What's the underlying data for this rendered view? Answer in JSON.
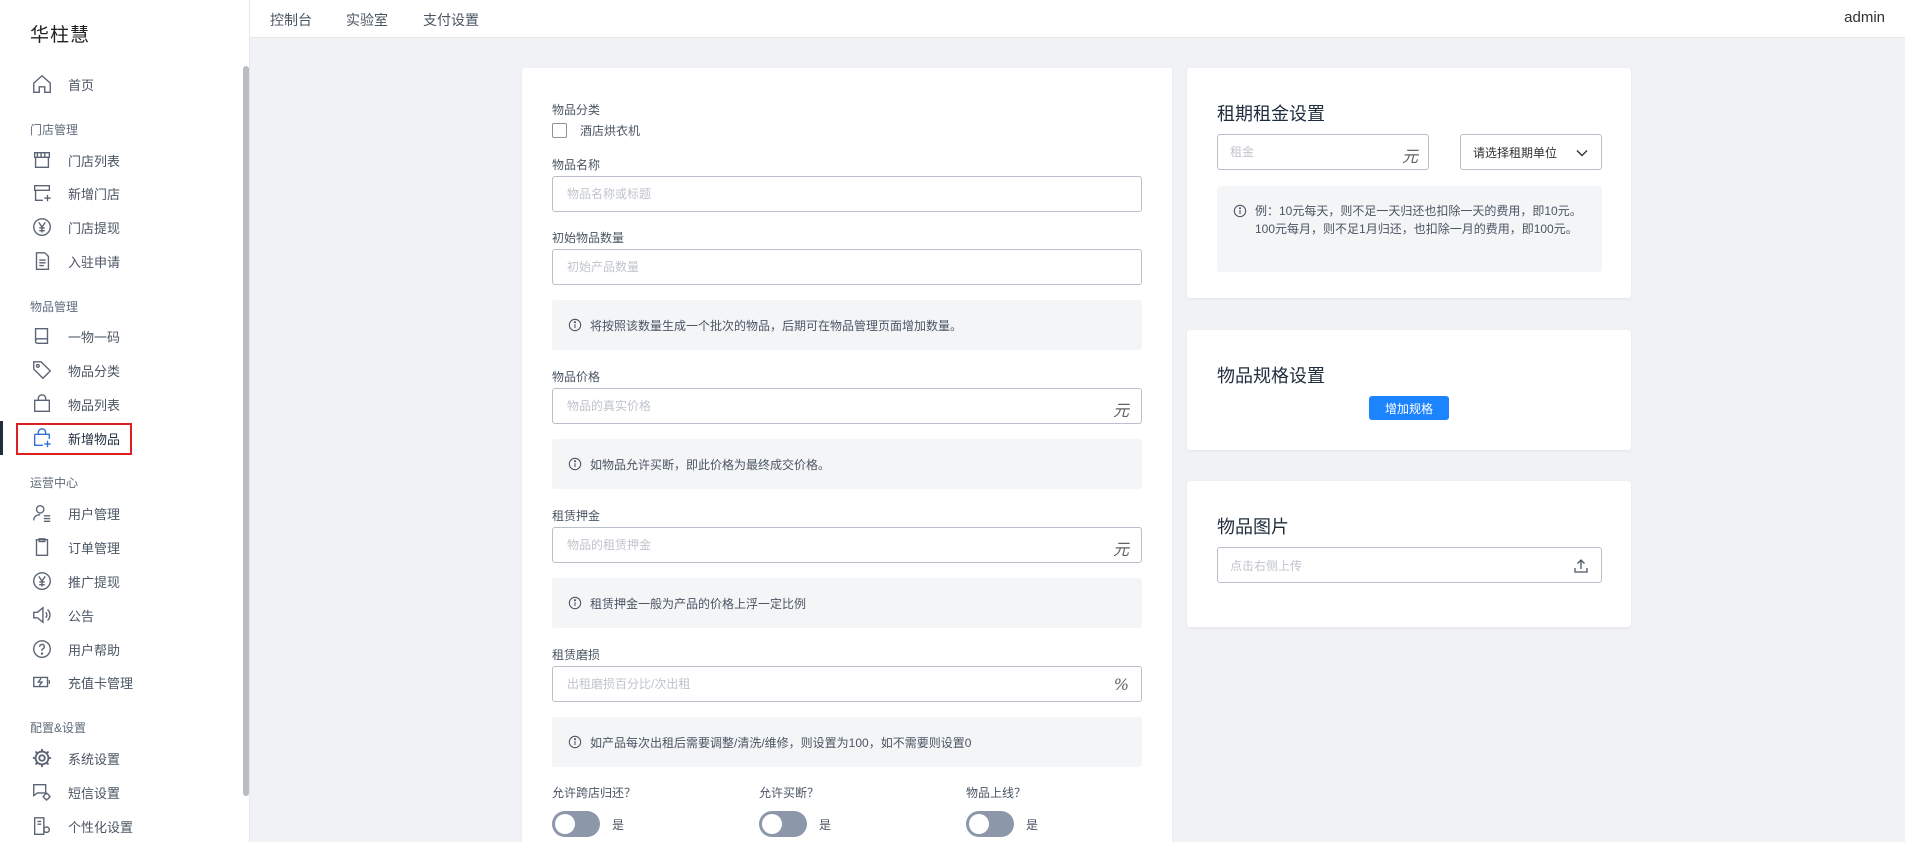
{
  "app": {
    "brand": "华柱慧",
    "user": "admin"
  },
  "topnav": [
    {
      "label": "控制台"
    },
    {
      "label": "实验室"
    },
    {
      "label": "支付设置"
    }
  ],
  "sidebar": {
    "home": {
      "label": "首页",
      "icon": "home-icon"
    },
    "sections": [
      {
        "title": "门店管理",
        "items": [
          {
            "label": "门店列表",
            "icon": "store-icon"
          },
          {
            "label": "新增门店",
            "icon": "add-store-icon"
          },
          {
            "label": "门店提现",
            "icon": "yen-icon"
          },
          {
            "label": "入驻申请",
            "icon": "document-icon"
          }
        ]
      },
      {
        "title": "物品管理",
        "items": [
          {
            "label": "一物一码",
            "icon": "book-icon"
          },
          {
            "label": "物品分类",
            "icon": "tag-icon"
          },
          {
            "label": "物品列表",
            "icon": "bag-icon"
          },
          {
            "label": "新增物品",
            "icon": "add-bag-icon",
            "active": true
          }
        ]
      },
      {
        "title": "运营中心",
        "items": [
          {
            "label": "用户管理",
            "icon": "user-icon"
          },
          {
            "label": "订单管理",
            "icon": "clipboard-icon"
          },
          {
            "label": "推广提现",
            "icon": "yen-icon"
          },
          {
            "label": "公告",
            "icon": "speaker-icon"
          },
          {
            "label": "用户帮助",
            "icon": "help-icon"
          },
          {
            "label": "充值卡管理",
            "icon": "battery-charge-icon"
          }
        ]
      },
      {
        "title": "配置&设置",
        "items": [
          {
            "label": "系统设置",
            "icon": "gear-icon"
          },
          {
            "label": "短信设置",
            "icon": "sms-settings-icon"
          },
          {
            "label": "个性化设置",
            "icon": "personalize-icon"
          }
        ]
      }
    ]
  },
  "form": {
    "category_label": "物品分类",
    "category_option": "酒店烘衣机",
    "name_label": "物品名称",
    "name_placeholder": "物品名称或标题",
    "qty_label": "初始物品数量",
    "qty_placeholder": "初始产品数量",
    "qty_tip": "将按照该数量生成一个批次的物品，后期可在物品管理页面增加数量。",
    "price_label": "物品价格",
    "price_placeholder": "物品的真实价格",
    "price_suffix": "元",
    "price_tip": "如物品允许买断，即此价格为最终成交价格。",
    "deposit_label": "租赁押金",
    "deposit_placeholder": "物品的租赁押金",
    "deposit_suffix": "元",
    "deposit_tip": "租赁押金一般为产品的价格上浮一定比例",
    "wear_label": "租赁磨损",
    "wear_placeholder": "出租磨损百分比/次出租",
    "wear_suffix": "%",
    "wear_tip": "如产品每次出租后需要调整/清洗/维修，则设置为100，如不需要则设置0",
    "switches": [
      {
        "question": "允许跨店归还？",
        "value": "是"
      },
      {
        "question": "允许买断？",
        "value": "是"
      },
      {
        "question": "物品上线？",
        "value": "是"
      }
    ]
  },
  "rent": {
    "title": "租期租金设置",
    "rent_placeholder": "租金",
    "rent_suffix": "元",
    "unit_select": "请选择租期单位",
    "tip": "例：10元每天，则不足一天归还也扣除一天的费用，即10元。100元每月，则不足1月归还，也扣除一月的费用，即100元。"
  },
  "spec": {
    "title": "物品规格设置",
    "add_button": "增加规格"
  },
  "images": {
    "title": "物品图片",
    "upload_placeholder": "点击右侧上传"
  }
}
